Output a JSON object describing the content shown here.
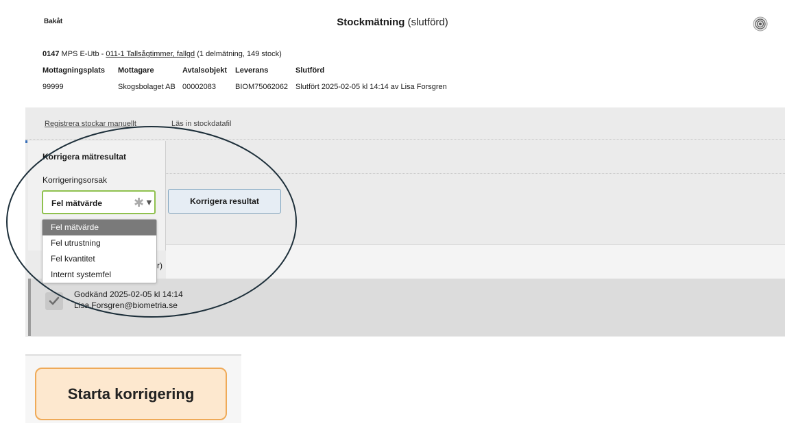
{
  "header": {
    "back_label": "Bakåt",
    "title": "Stockmätning",
    "status": "(slutförd)",
    "target_icon": "target-icon"
  },
  "info": {
    "id": "0147",
    "prefix": "MPS E-Utb - ",
    "link": "011-1 Tallsågtimmer, fallgd",
    "suffix": " (1 delmätning, 149 stock)"
  },
  "table": {
    "headers": [
      "Mottagningsplats",
      "Mottagare",
      "Avtalsobjekt",
      "Leverans",
      "Slutförd"
    ],
    "values": [
      "99999",
      "Skogsbolaget AB",
      "00002083",
      "BIOM75062062",
      "Slutfört 2025-02-05 kl 14:14 av Lisa Forsgren"
    ]
  },
  "actions": {
    "register_manual": "Registrera stockar manuellt",
    "read_file": "Läs in stockdatafil"
  },
  "correction": {
    "section_title": "Korrigera mätresultat",
    "reason_label": "Korrigeringsorsak",
    "selected": "Fel mätvärde",
    "options": [
      "Fel mätvärde",
      "Fel utrustning",
      "Fel kvantitet",
      "Internt systemfel"
    ],
    "button": "Korrigera resultat"
  },
  "partial_text": "r)",
  "approval": {
    "line1": "Godkänd 2025-02-05 kl 14:14",
    "line2": "Lisa.Forsgren@biometria.se"
  },
  "start_button": "Starta korrigering"
}
